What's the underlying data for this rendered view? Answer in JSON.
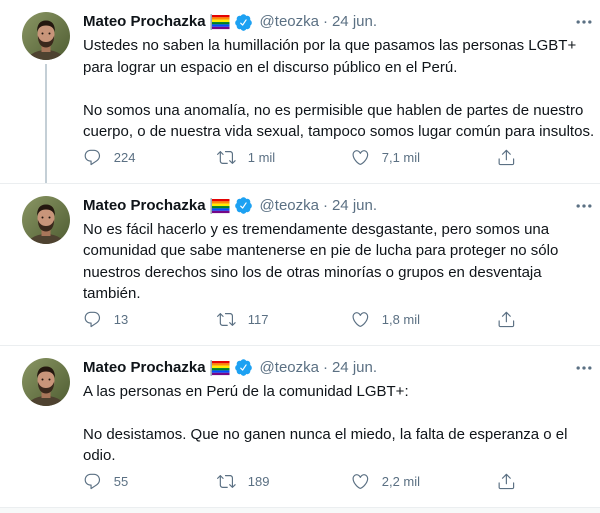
{
  "thread": [
    {
      "author": {
        "name": "Mateo Prochazka",
        "handle": "@teozka",
        "verified": true,
        "name_emoji": "rainbow-flag-icon"
      },
      "separator": "·",
      "date": "24 jun.",
      "text": "Ustedes no saben la humillación por la que pasamos las personas LGBT+\npara lograr un espacio en el discurso público en el Perú.\n\nNo somos una anomalía, no es permisible que hablen de partes de nuestro\ncuerpo, o de nuestra vida sexual, tampoco somos lugar común para insultos.",
      "actions": {
        "replies": "224",
        "retweets": "1 mil",
        "likes": "7,1 mil"
      }
    },
    {
      "author": {
        "name": "Mateo Prochazka",
        "handle": "@teozka",
        "verified": true,
        "name_emoji": "rainbow-flag-icon"
      },
      "separator": "·",
      "date": "24 jun.",
      "text": "No es fácil hacerlo y es tremendamente desgastante, pero somos una\ncomunidad que sabe mantenerse en pie de lucha para proteger no sólo\nnuestros derechos sino los de otras minorías o grupos en desventaja\ntambién.",
      "actions": {
        "replies": "13",
        "retweets": "117",
        "likes": "1,8 mil"
      }
    },
    {
      "author": {
        "name": "Mateo Prochazka",
        "handle": "@teozka",
        "verified": true,
        "name_emoji": "rainbow-flag-icon"
      },
      "separator": "·",
      "date": "24 jun.",
      "text": "A las personas en Perú de la comunidad LGBT+:\n\nNo desistamos. Que no ganen nunca el miedo, la falta de esperanza o el\nodio.",
      "actions": {
        "replies": "55",
        "retweets": "189",
        "likes": "2,2 mil"
      }
    }
  ],
  "icons": {
    "reply": "reply-icon",
    "retweet": "retweet-icon",
    "like": "heart-icon",
    "share": "share-icon",
    "verified": "verified-badge-icon",
    "more": "more-icon",
    "flag": "rainbow-flag-icon"
  },
  "colors": {
    "text": "#0F1419",
    "secondary": "#5B7083",
    "verified": "#1DA1F2",
    "border": "#EBEEF0",
    "thread_line": "#C4CFD6"
  }
}
